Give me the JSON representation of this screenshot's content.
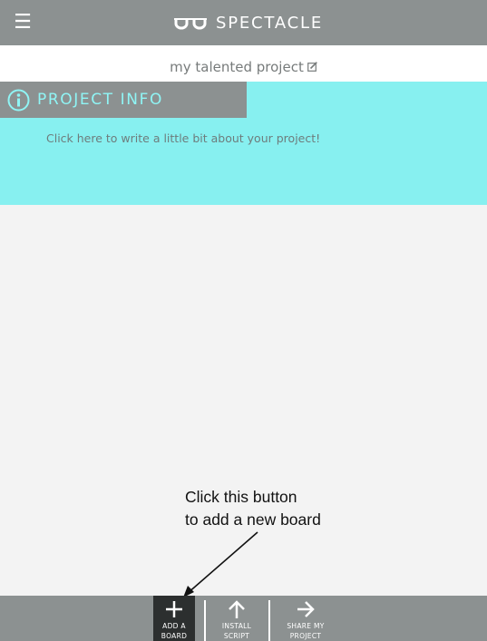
{
  "header": {
    "menu_icon": "hamburger-icon",
    "logo_icon": "glasses-icon",
    "logo_text": "SPECTACLE"
  },
  "project": {
    "title": "my talented project",
    "edit_icon": "edit-icon"
  },
  "info": {
    "icon": "info-icon",
    "label": "PROJECT INFO",
    "description": "Click here to write a little bit about your project!"
  },
  "annotation": {
    "line1": "Click this button",
    "line2": "to add a new board"
  },
  "toolbar": {
    "add_board_label": "ADD A\nBOARD",
    "install_script_label": "INSTALL\nSCRIPT",
    "share_label": "SHARE MY\nPROJECT"
  },
  "colors": {
    "header_bg": "#8c9191",
    "info_bg": "#87f0f0",
    "info_label": "#8ff5f5",
    "active_button": "#2c2f2f"
  }
}
